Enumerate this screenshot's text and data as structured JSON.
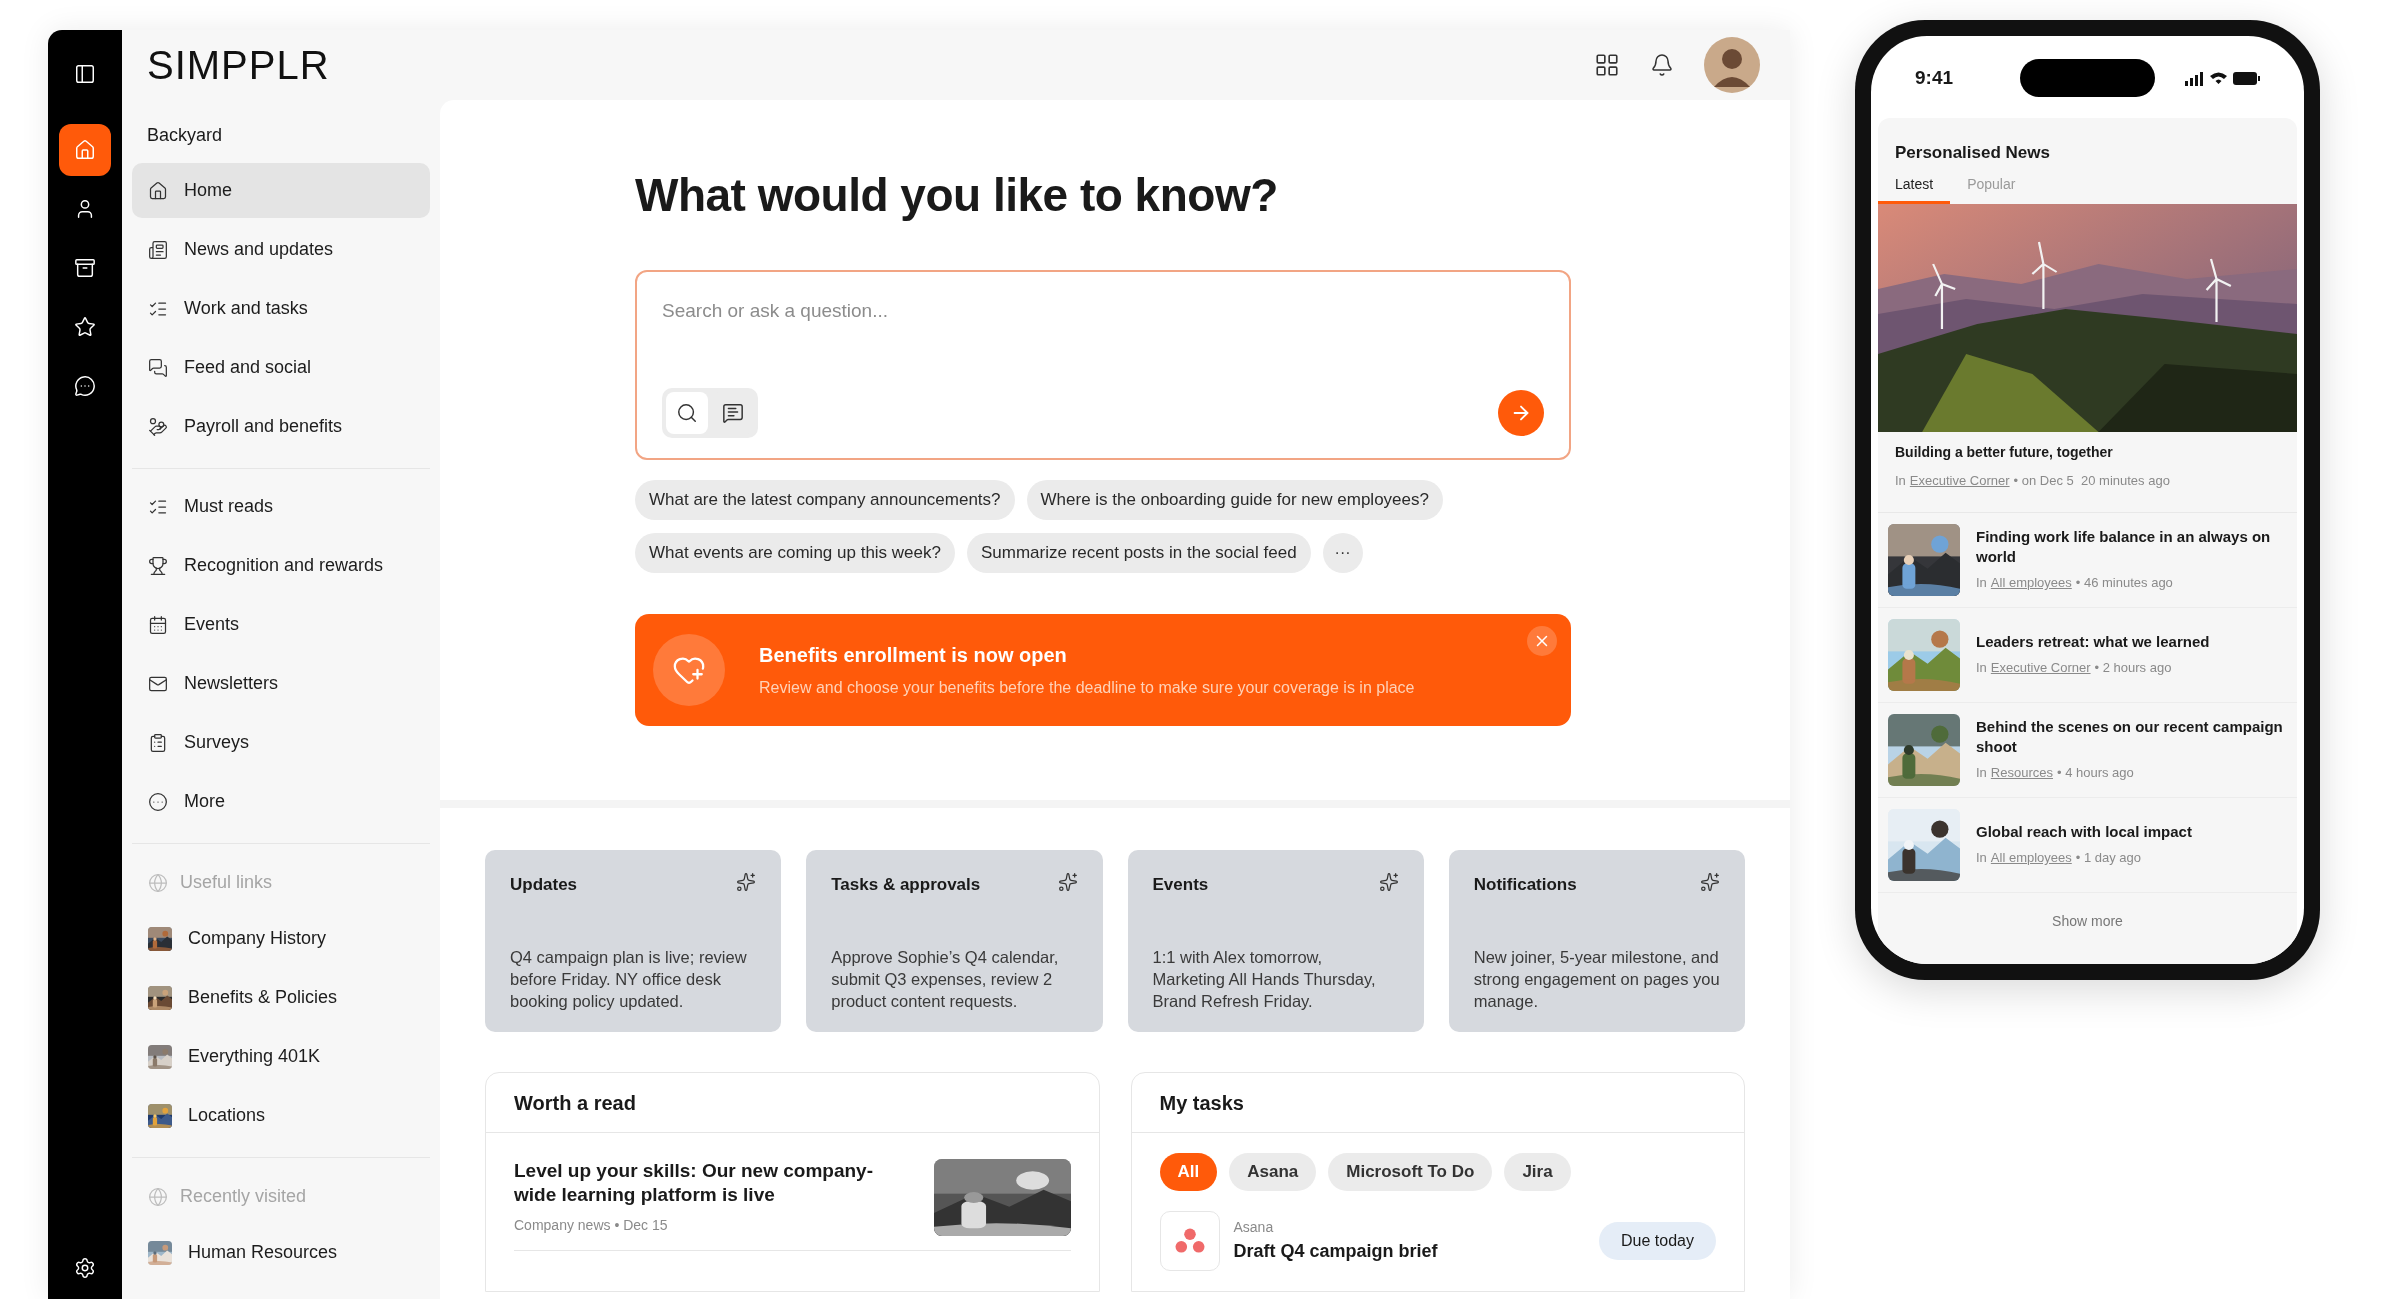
{
  "logo": "SIMPPLR",
  "rail": [
    {
      "selected": false
    },
    {
      "selected": true
    },
    {
      "selected": false
    },
    {
      "selected": false
    },
    {
      "selected": false
    },
    {
      "selected": false
    }
  ],
  "sidebar": {
    "workspace": "Backyard",
    "sections": [
      {
        "items": [
          {
            "label": "Home",
            "selected": true
          },
          {
            "label": "News and updates",
            "selected": false
          },
          {
            "label": "Work and tasks",
            "selected": false
          },
          {
            "label": "Feed and social",
            "selected": false
          },
          {
            "label": "Payroll and benefits",
            "selected": false
          }
        ]
      },
      {
        "items": [
          {
            "label": "Must reads",
            "selected": false
          },
          {
            "label": "Recognition and rewards",
            "selected": false
          },
          {
            "label": "Events",
            "selected": false
          },
          {
            "label": "Newsletters",
            "selected": false
          },
          {
            "label": "Surveys",
            "selected": false
          },
          {
            "label": "More",
            "selected": false
          }
        ]
      },
      {
        "heading": "Useful links",
        "items": [
          {
            "label": "Company History",
            "selected": false
          },
          {
            "label": "Benefits & Policies",
            "selected": false
          },
          {
            "label": "Everything 401K",
            "selected": false
          },
          {
            "label": "Locations",
            "selected": false
          }
        ]
      },
      {
        "heading": "Recently visited",
        "items": [
          {
            "label": "Human Resources",
            "selected": false
          }
        ]
      }
    ]
  },
  "main": {
    "heading": "What would you like to know?",
    "search": {
      "placeholder": "Search or ask a question...",
      "modes": [
        {
          "selected": true
        },
        {
          "selected": false
        }
      ]
    },
    "suggestions": [
      "What are the latest company announcements?",
      "Where is the onboarding guide for new employees?",
      "What events are coming up this week?",
      "Summarize recent posts in the social feed"
    ],
    "more_label": "···",
    "banner": {
      "title": "Benefits enrollment is now open",
      "text": "Review and choose your benefits before the deadline to make sure your coverage is in place"
    },
    "summary_cards": [
      {
        "title": "Updates",
        "text": "Q4 campaign plan is live; review before Friday. NY office desk booking policy updated."
      },
      {
        "title": "Tasks & approvals",
        "text": "Approve Sophie’s Q4 calendar, submit Q3 expenses, review 2 product content requests."
      },
      {
        "title": "Events",
        "text": "1:1 with Alex tomorrow, Marketing All Hands Thursday, Brand Refresh Friday."
      },
      {
        "title": "Notifications",
        "text": "New joiner, 5-year milestone, and strong engagement on pages you manage."
      }
    ],
    "worth_a_read": {
      "title": "Worth a read",
      "articles": [
        {
          "title": "Level up your skills: Our new company-wide learning platform is live",
          "meta": "Company news • Dec 15"
        }
      ]
    },
    "my_tasks": {
      "title": "My tasks",
      "filters": [
        {
          "label": "All",
          "selected": true
        },
        {
          "label": "Asana",
          "selected": false
        },
        {
          "label": "Microsoft To Do",
          "selected": false
        },
        {
          "label": "Jira",
          "selected": false
        }
      ],
      "tasks": [
        {
          "source": "Asana",
          "title": "Draft Q4 campaign brief",
          "due": "Due today"
        }
      ]
    }
  },
  "phone": {
    "time": "9:41",
    "news": {
      "title": "Personalised News",
      "tabs": [
        {
          "label": "Latest",
          "selected": true
        },
        {
          "label": "Popular",
          "selected": false
        }
      ],
      "featured": {
        "title": "Building a better future, together",
        "prefix": "In",
        "channel": "Executive Corner",
        "when": "• on Dec 5  20 minutes ago"
      },
      "items": [
        {
          "title": "Finding work life balance in an always on world",
          "prefix": "In",
          "channel": "All employees",
          "when": "• 46 minutes ago"
        },
        {
          "title": "Leaders retreat: what we learned",
          "prefix": "In",
          "channel": "Executive Corner",
          "when": "• 2 hours ago"
        },
        {
          "title": "Behind the scenes on our recent campaign shoot",
          "prefix": "In",
          "channel": "Resources",
          "when": "• 4 hours ago"
        },
        {
          "title": "Global reach with local impact",
          "prefix": "In",
          "channel": "All employees",
          "when": "• 1 day ago"
        }
      ],
      "show_more": "Show more"
    }
  }
}
